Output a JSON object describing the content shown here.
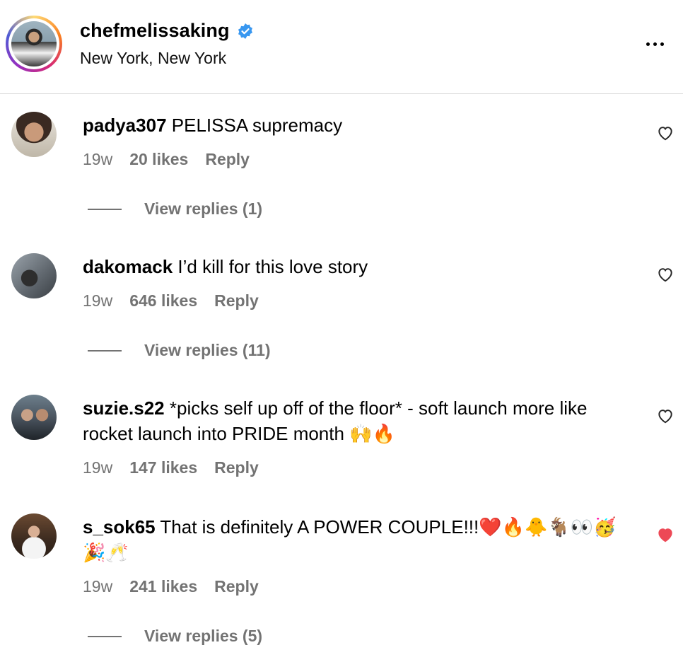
{
  "header": {
    "username": "chefmelissaking",
    "location": "New York, New York"
  },
  "comments": [
    {
      "username": "padya307",
      "text": "PELISSA supremacy",
      "time": "19w",
      "likes": "20 likes",
      "reply": "Reply",
      "view_replies": "View replies (1)",
      "liked": false
    },
    {
      "username": "dakomack",
      "text": "I’d kill for this love story",
      "time": "19w",
      "likes": "646 likes",
      "reply": "Reply",
      "view_replies": "View replies (11)",
      "liked": false
    },
    {
      "username": "suzie.s22",
      "text": "*picks self up off of the floor* - soft launch more like rocket launch into PRIDE month 🙌🔥",
      "time": "19w",
      "likes": "147 likes",
      "reply": "Reply",
      "liked": false
    },
    {
      "username": "s_sok65",
      "text": "That is definitely A POWER COUPLE!!!❤️🔥🐥🐐👀🥳🎉🥂",
      "time": "19w",
      "likes": "241 likes",
      "reply": "Reply",
      "view_replies": "View replies (5)",
      "liked": true
    }
  ],
  "colors": {
    "verified": "#3897f0",
    "muted": "#737373",
    "liked_heart": "#ed4956"
  }
}
